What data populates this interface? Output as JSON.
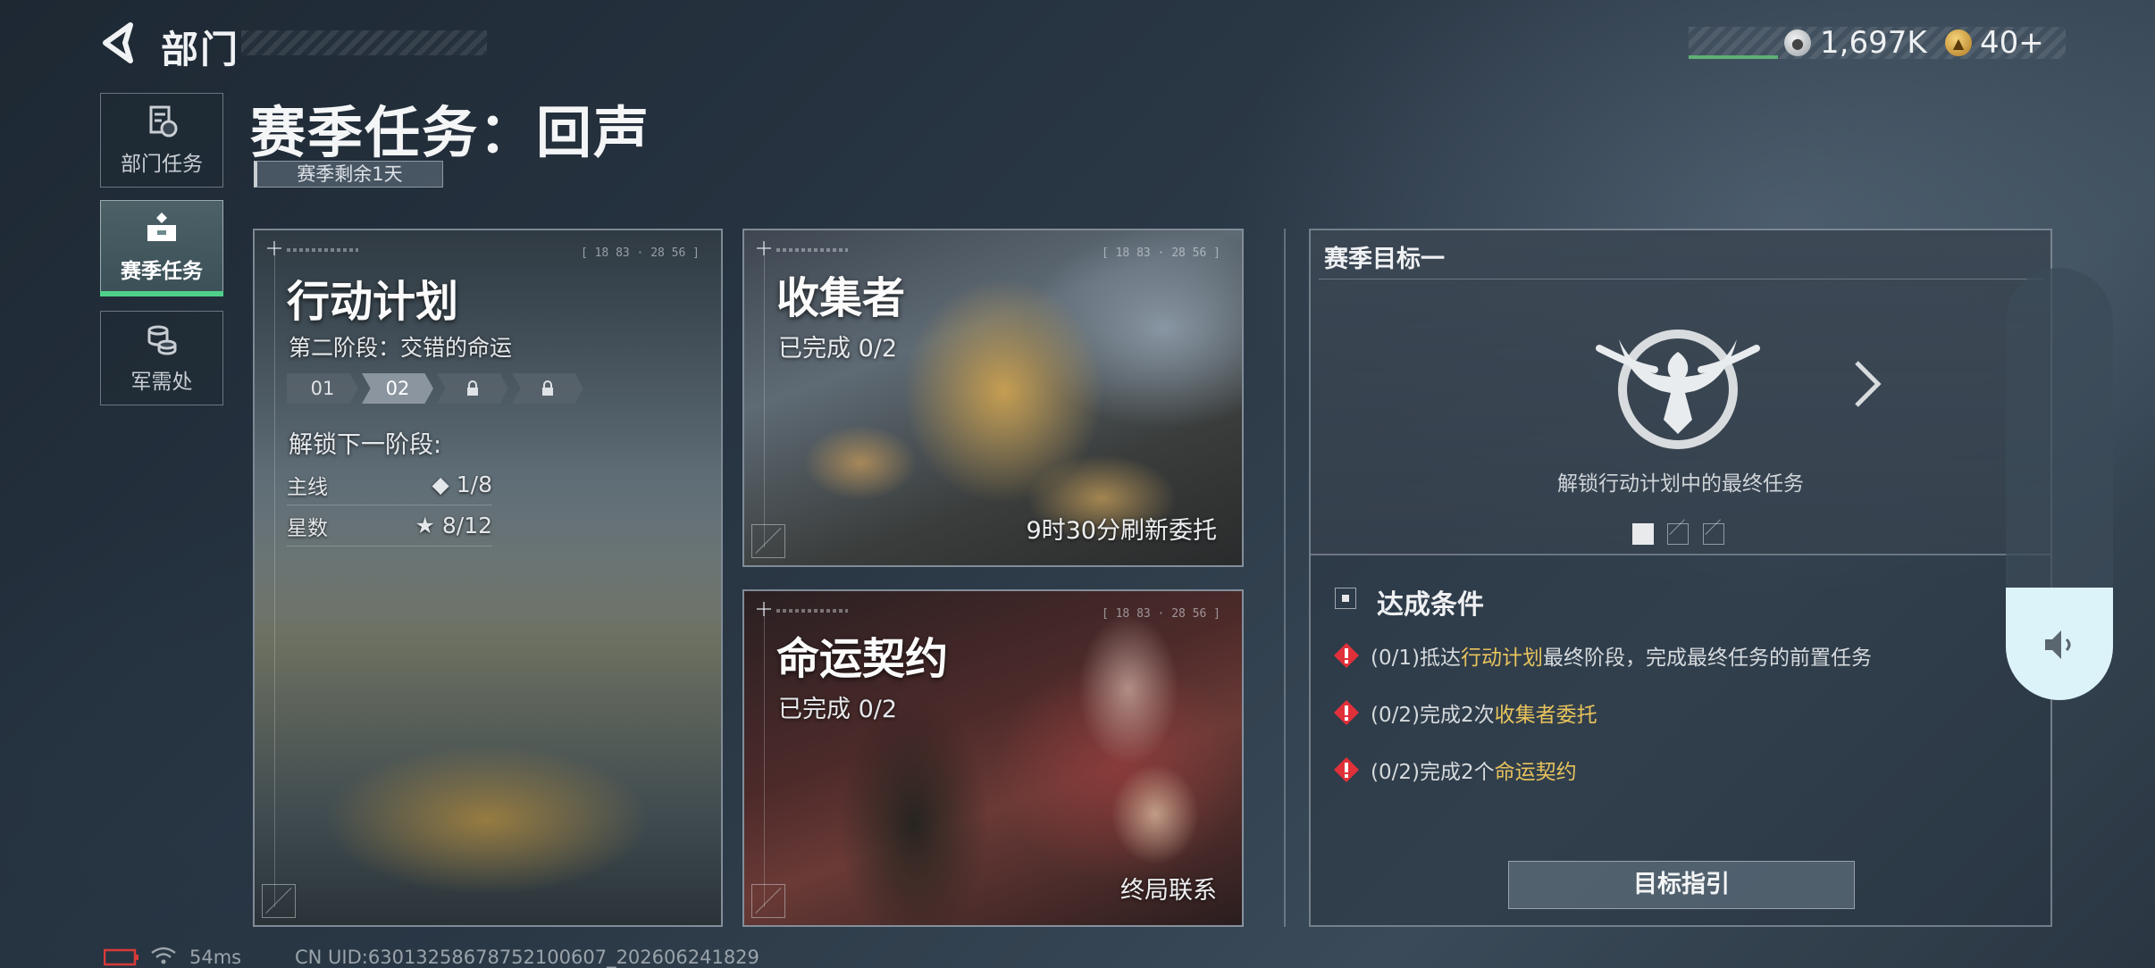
{
  "header": {
    "title": "部门",
    "coins": "1,697K",
    "tickets": "40+"
  },
  "sidebar": {
    "items": [
      {
        "label": "部门任务",
        "icon": "document-icon"
      },
      {
        "label": "赛季任务",
        "icon": "briefcase-icon",
        "active": true
      },
      {
        "label": "军需处",
        "icon": "coin-stack-icon"
      }
    ]
  },
  "page": {
    "title": "赛季任务：回声",
    "season_remaining": "赛季剩余1天"
  },
  "cards": {
    "plan": {
      "tag": "[ 18 83 · 28 56 ]",
      "title": "行动计划",
      "phase": "第二阶段：交错的命运",
      "stages": [
        "01",
        "02"
      ],
      "locked_stage_count": 2,
      "unlock_label": "解锁下一阶段:",
      "requirements": [
        {
          "label": "主线",
          "icon": "◆",
          "value": "1/8"
        },
        {
          "label": "星数",
          "icon": "★",
          "value": "8/12"
        }
      ]
    },
    "collector": {
      "tag": "[ 18 83 · 28 56 ]",
      "title": "收集者",
      "progress": "已完成 0/2",
      "refresh": "9时30分刷新委托"
    },
    "contract": {
      "tag": "[ 18 83 · 28 56 ]",
      "title": "命运契约",
      "progress": "已完成 0/2",
      "footer": "终局联系"
    }
  },
  "goal": {
    "title": "赛季目标一",
    "description": "解锁行动计划中的最终任务",
    "page_count": 3,
    "current_page": 1,
    "conditions_title": "达成条件",
    "conditions": [
      {
        "prefix": "(0/1)抵达",
        "highlight": "行动计划",
        "suffix": "最终阶段，完成最终任务的前置任务"
      },
      {
        "prefix": "(0/2)完成2次",
        "highlight": "收集者委托",
        "suffix": ""
      },
      {
        "prefix": "(0/2)完成2个",
        "highlight": "命运契约",
        "suffix": ""
      }
    ],
    "guide_button": "目标指引"
  },
  "volume": {
    "level": 0.26
  },
  "status": {
    "ping": "54ms",
    "uid": "CN UID:63013258678752100607_202606241829"
  },
  "colors": {
    "active_green": "#4fd08a",
    "highlight_gold": "#e8c35c",
    "warning_red": "#e0303a"
  }
}
